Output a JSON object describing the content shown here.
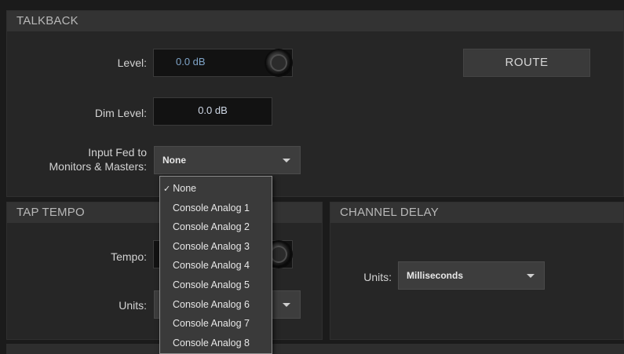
{
  "talkback": {
    "title": "TALKBACK",
    "level_label": "Level:",
    "level_value": "0.0 dB",
    "route_label": "ROUTE",
    "dim_label": "Dim Level:",
    "dim_value": "0.0 dB",
    "input_fed_line1": "Input Fed to",
    "input_fed_line2": "Monitors & Masters:",
    "input_fed_value": "None"
  },
  "dropdown": {
    "items": [
      {
        "label": "None",
        "checked": true
      },
      {
        "label": "Console Analog 1"
      },
      {
        "label": "Console Analog 2"
      },
      {
        "label": "Console Analog 3"
      },
      {
        "label": "Console Analog 4"
      },
      {
        "label": "Console Analog 5"
      },
      {
        "label": "Console Analog 6"
      },
      {
        "label": "Console Analog 7"
      },
      {
        "label": "Console Analog 8"
      }
    ],
    "check_glyph": "✓"
  },
  "tap_tempo": {
    "title": "TAP TEMPO",
    "tempo_label": "Tempo:",
    "units_label": "Units:"
  },
  "channel_delay": {
    "title": "CHANNEL DELAY",
    "units_label": "Units:",
    "units_value": "Milliseconds"
  }
}
